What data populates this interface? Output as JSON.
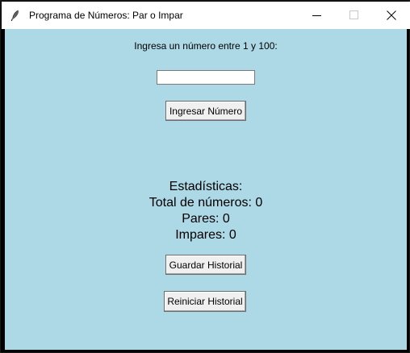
{
  "window": {
    "title": "Programa de Números: Par o Impar",
    "icon": "feather-icon"
  },
  "form": {
    "prompt": "Ingresa un número entre 1 y 100:",
    "input_value": "",
    "submit_label": "Ingresar Número"
  },
  "stats": {
    "heading": "Estadísticas:",
    "total": "Total de números: 0",
    "pares": "Pares: 0",
    "impares": "Impares: 0"
  },
  "actions": {
    "save_label": "Guardar Historial",
    "reset_label": "Reiniciar Historial"
  },
  "colors": {
    "background": "#add8e6",
    "titlebar": "#ffffff"
  }
}
